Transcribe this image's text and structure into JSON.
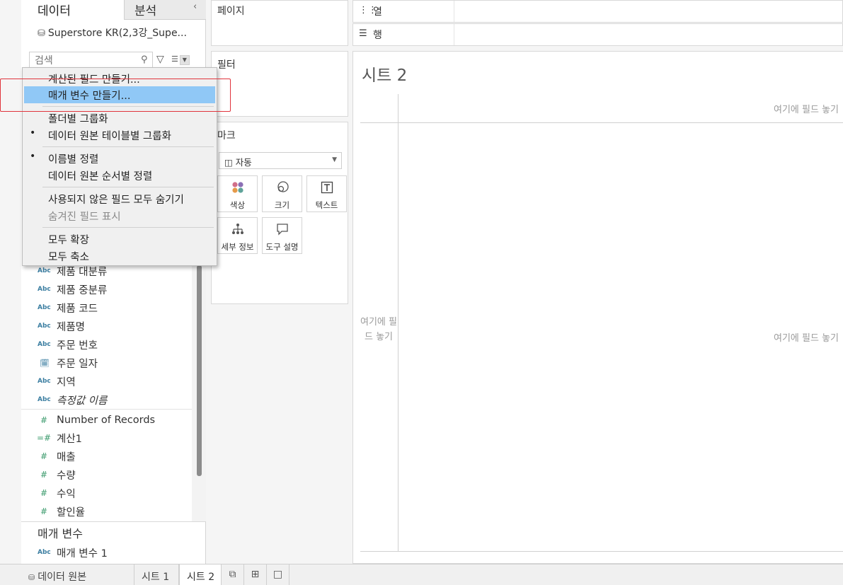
{
  "data_pane": {
    "tab_data": "데이터",
    "tab_analysis": "분석",
    "datasource_name": "Superstore KR(2,3강_Supe...",
    "search_placeholder": "검색",
    "fields": [
      {
        "type": "Abc",
        "label": "제품 대분류"
      },
      {
        "type": "Abc",
        "label": "제품 중분류"
      },
      {
        "type": "Abc",
        "label": "제품 코드"
      },
      {
        "type": "Abc",
        "label": "제품명"
      },
      {
        "type": "Abc",
        "label": "주문 번호"
      },
      {
        "type": "calendar",
        "label": "주문 일자"
      },
      {
        "type": "Abc",
        "label": "지역"
      },
      {
        "type": "Abc",
        "label": "측정값 이름"
      }
    ],
    "measures": [
      {
        "type": "#",
        "label": "Number of Records"
      },
      {
        "type": "=#",
        "label": "계산1"
      },
      {
        "type": "#",
        "label": "매출"
      },
      {
        "type": "#",
        "label": "수량"
      },
      {
        "type": "#",
        "label": "수익"
      },
      {
        "type": "#",
        "label": "할인율"
      }
    ],
    "parameters_header": "매개 변수",
    "parameters": [
      {
        "type": "Abc",
        "label": "매개 변수 1"
      }
    ]
  },
  "context_menu": {
    "items": [
      {
        "label": "계산된 필드 만들기...",
        "bullet": false,
        "disabled": false,
        "highlighted": false
      },
      {
        "label": "매개 변수 만들기...",
        "bullet": false,
        "disabled": false,
        "highlighted": true
      },
      {
        "label": "폴더별 그룹화",
        "bullet": false,
        "disabled": false,
        "highlighted": false
      },
      {
        "label": "데이터 원본 테이블별 그룹화",
        "bullet": true,
        "disabled": false,
        "highlighted": false
      },
      {
        "label": "이름별 정렬",
        "bullet": true,
        "disabled": false,
        "highlighted": false
      },
      {
        "label": "데이터 원본 순서별 정렬",
        "bullet": false,
        "disabled": false,
        "highlighted": false
      },
      {
        "label": "사용되지 않은 필드 모두 숨기기",
        "bullet": false,
        "disabled": false,
        "highlighted": false
      },
      {
        "label": "숨겨진 필드 표시",
        "bullet": false,
        "disabled": true,
        "highlighted": false
      },
      {
        "label": "모두 확장",
        "bullet": false,
        "disabled": false,
        "highlighted": false
      },
      {
        "label": "모두 축소",
        "bullet": false,
        "disabled": false,
        "highlighted": false
      }
    ],
    "bullet_char": "•"
  },
  "shelves": {
    "pages": "페이지",
    "filters": "필터",
    "marks": "마크",
    "marks_type": "자동",
    "mark_buttons": {
      "color": "색상",
      "size": "크기",
      "text": "텍스트",
      "detail": "세부 정보",
      "tooltip": "도구 설명"
    },
    "columns": "열",
    "rows": "행"
  },
  "sheet": {
    "title": "시트 2",
    "drop_columns": "여기에 필드 놓기",
    "drop_body": "여기에 필드 놓기",
    "drop_rows": "여기에 필드 놓기"
  },
  "bottom_bar": {
    "datasource_tab": "데이터 원본",
    "sheet_tabs": [
      "시트 1",
      "시트 2"
    ],
    "active_sheet": "시트 2"
  },
  "colors": {
    "menu_highlight": "#90c8f6",
    "annotation_box": "#e0343c",
    "dimension_type": "#3b7ea1",
    "measure_type": "#3c9b6d"
  }
}
